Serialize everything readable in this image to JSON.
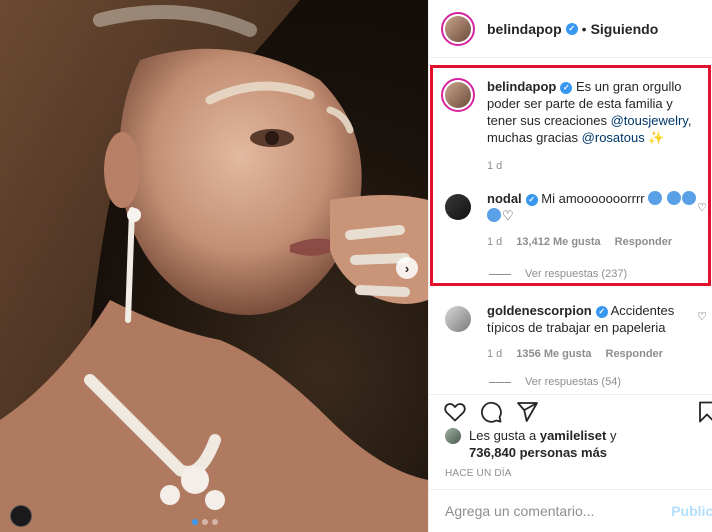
{
  "post": {
    "username": "belindapop",
    "follow_status": "Siguiendo",
    "separator": "•"
  },
  "caption": {
    "username": "belindapop",
    "text_1": "Es un gran orgullo poder ser parte de esta familia y tener sus creaciones",
    "mention_1": "@tousjewelry",
    "text_2": ", muchas gracias",
    "mention_2": "@rosatous",
    "emoji": "✨",
    "age": "1 d"
  },
  "comments": [
    {
      "username": "nodal",
      "text": "Mi amooooooorrrr",
      "age": "1 d",
      "likes": "13,412 Me gusta",
      "reply_label": "Responder",
      "view_replies": "Ver respuestas (237)"
    },
    {
      "username": "goldenescorpion",
      "text": "Accidentes típicos de trabajar en papeleria",
      "age": "1 d",
      "likes": "1356 Me gusta",
      "reply_label": "Responder",
      "view_replies": "Ver respuestas (54)"
    }
  ],
  "likes": {
    "prefix": "Les gusta a",
    "user": "yamileliset",
    "conj": "y",
    "others": "736,840 personas más"
  },
  "timestamp": "HACE UN DÍA",
  "add_comment": {
    "placeholder": "Agrega un comentario...",
    "post_label": "Publica"
  },
  "icons": {
    "like": "heart-icon",
    "comment": "comment-icon",
    "share": "share-icon",
    "save": "bookmark-icon",
    "next": "chevron-right-icon"
  },
  "colors": {
    "highlight": "#e3102b",
    "verified": "#3897f0",
    "mention": "#00376b",
    "muted": "#8e8e8e"
  }
}
